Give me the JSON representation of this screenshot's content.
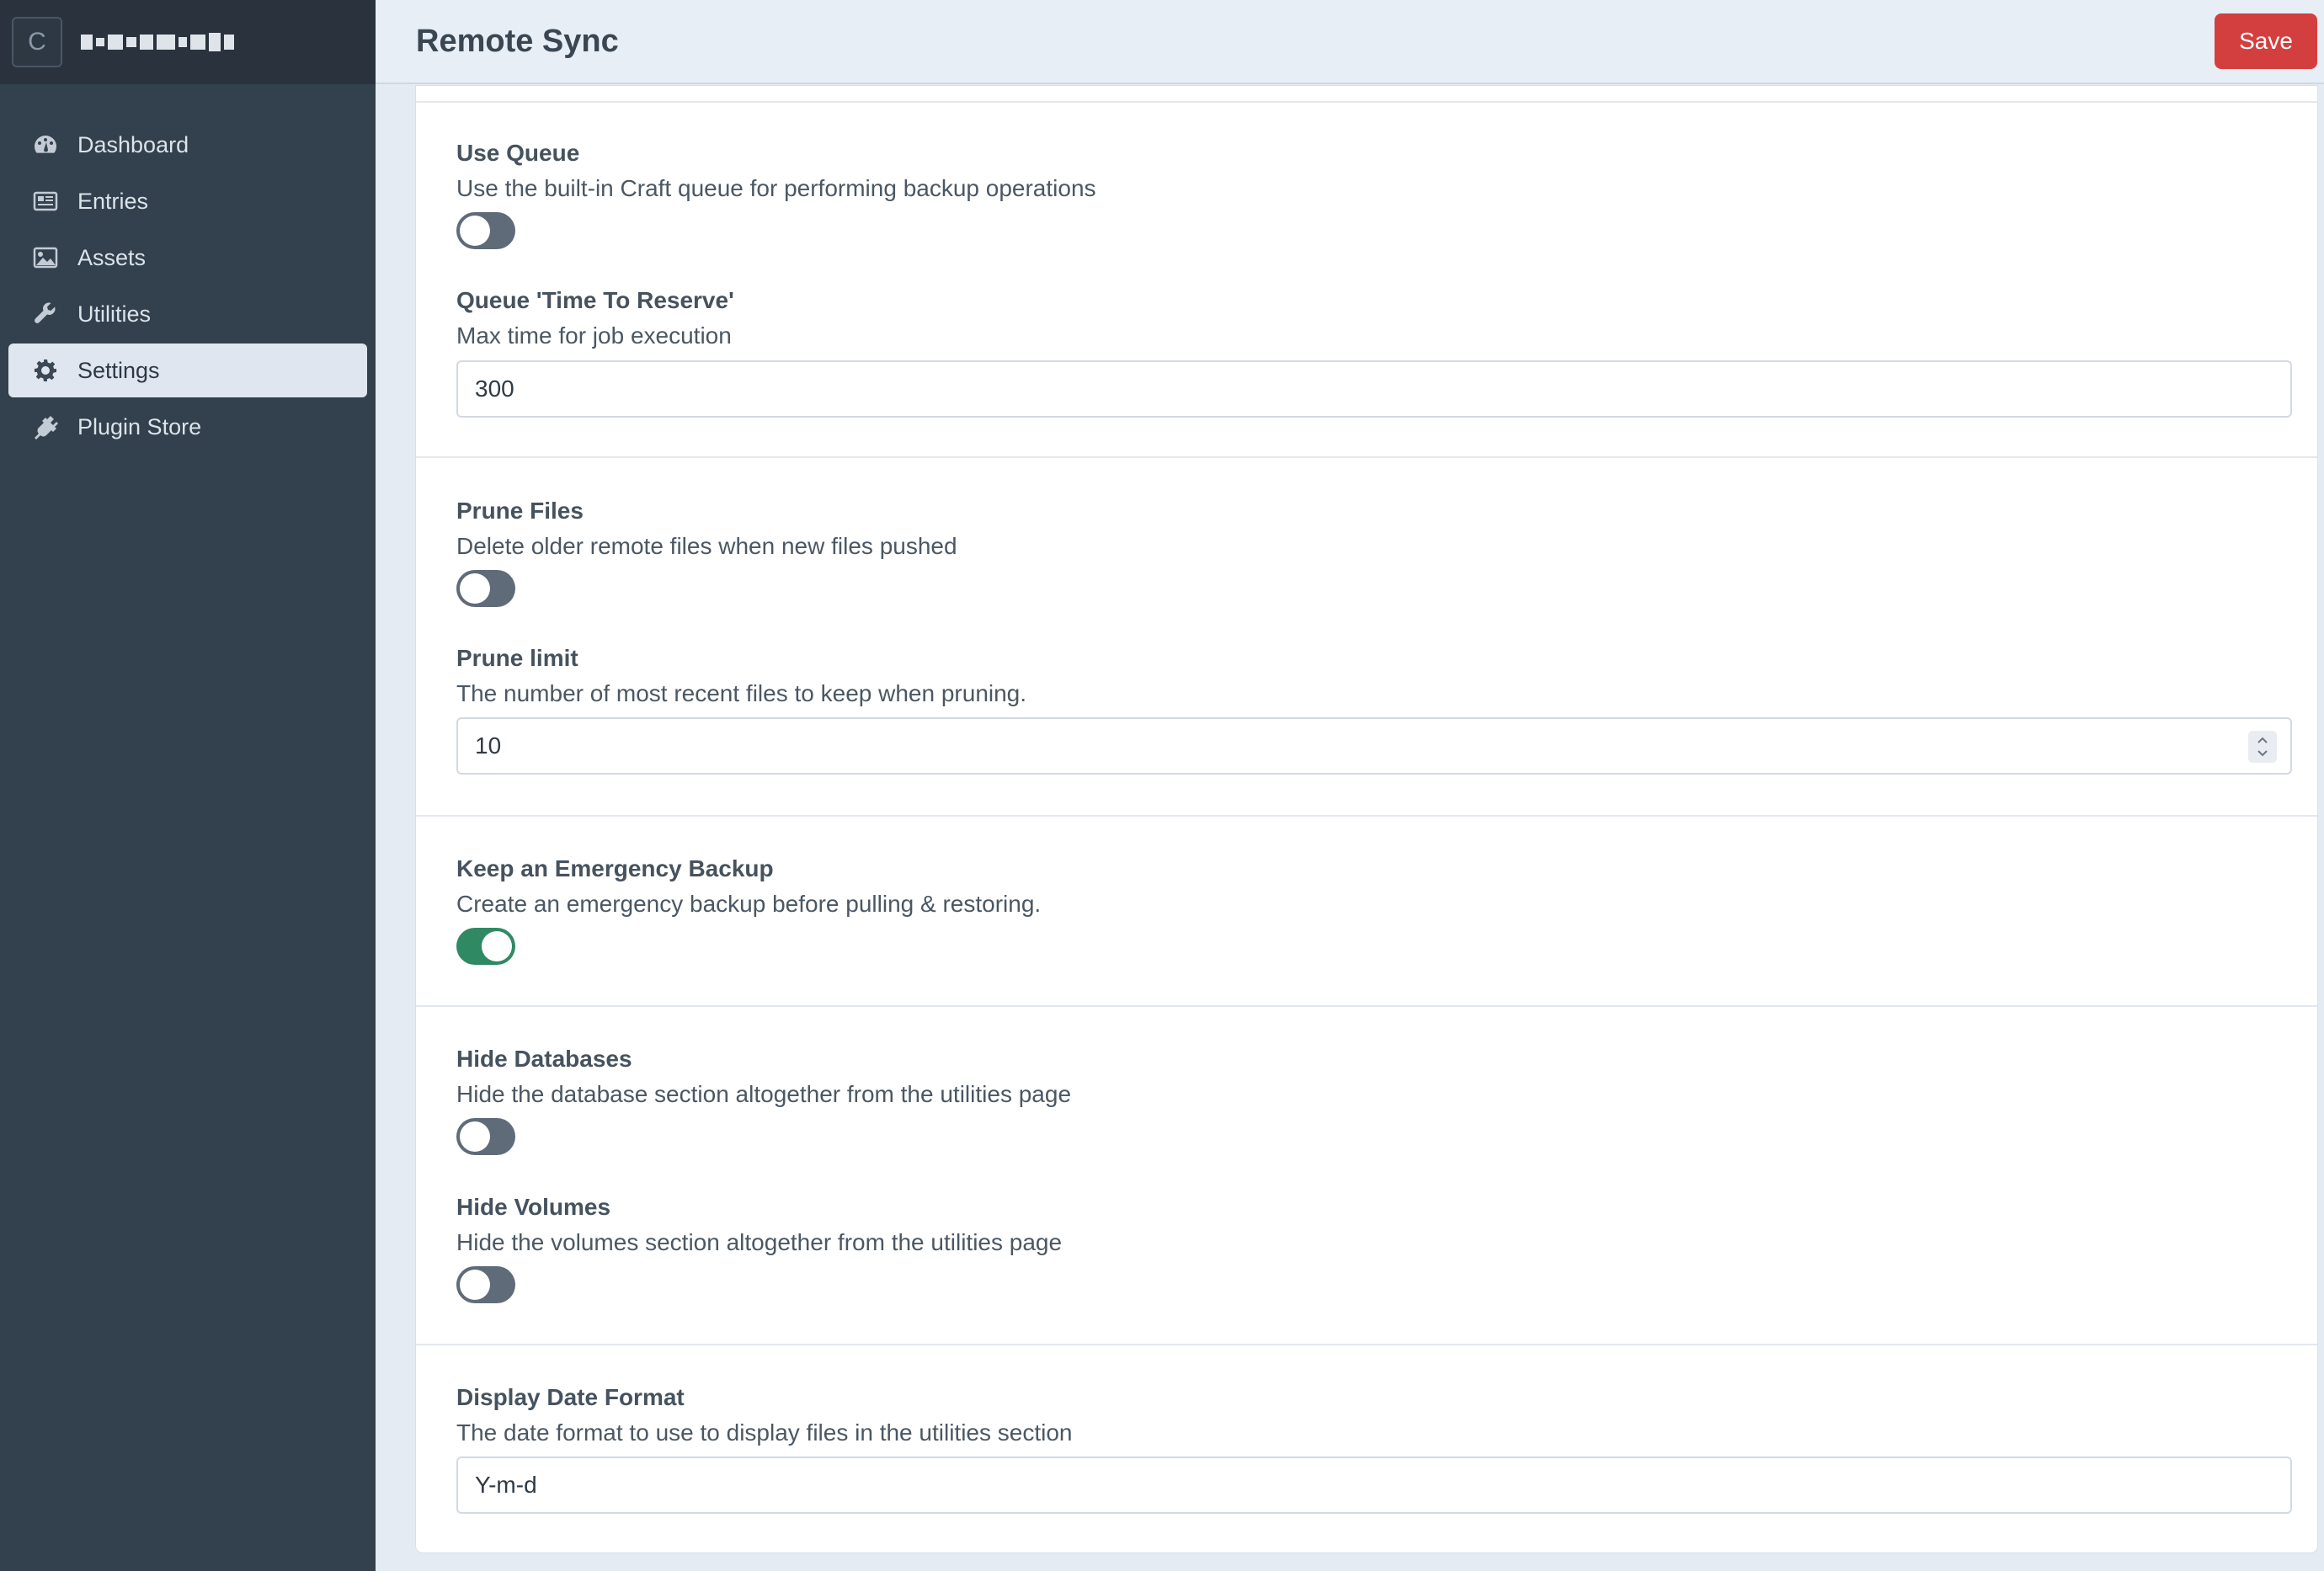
{
  "app": {
    "site_icon_letter": "C"
  },
  "header": {
    "title": "Remote Sync",
    "save_label": "Save"
  },
  "sidebar": {
    "items": [
      {
        "label": "Dashboard",
        "icon": "dashboard-icon"
      },
      {
        "label": "Entries",
        "icon": "entries-icon"
      },
      {
        "label": "Assets",
        "icon": "assets-icon"
      },
      {
        "label": "Utilities",
        "icon": "wrench-icon"
      },
      {
        "label": "Settings",
        "icon": "gear-icon",
        "active": true
      },
      {
        "label": "Plugin Store",
        "icon": "plug-icon"
      }
    ]
  },
  "settings": {
    "use_queue": {
      "label": "Use Queue",
      "desc": "Use the built-in Craft queue for performing backup operations",
      "enabled": false
    },
    "queue_ttr": {
      "label": "Queue 'Time To Reserve'",
      "desc": "Max time for job execution",
      "value": "300"
    },
    "prune_files": {
      "label": "Prune Files",
      "desc": "Delete older remote files when new files pushed",
      "enabled": false
    },
    "prune_limit": {
      "label": "Prune limit",
      "desc": "The number of most recent files to keep when pruning.",
      "value": "10"
    },
    "emergency_backup": {
      "label": "Keep an Emergency Backup",
      "desc": "Create an emergency backup before pulling & restoring.",
      "enabled": true
    },
    "hide_databases": {
      "label": "Hide Databases",
      "desc": "Hide the database section altogether from the utilities page",
      "enabled": false
    },
    "hide_volumes": {
      "label": "Hide Volumes",
      "desc": "Hide the volumes section altogether from the utilities page",
      "enabled": false
    },
    "date_format": {
      "label": "Display Date Format",
      "desc": "The date format to use to display files in the utilities section",
      "value": "Y-m-d"
    }
  },
  "colors": {
    "sidebar_bg": "#33404d",
    "save_red": "#d33f3f",
    "toggle_on": "#2f8a64",
    "toggle_off": "#5f6b78"
  }
}
